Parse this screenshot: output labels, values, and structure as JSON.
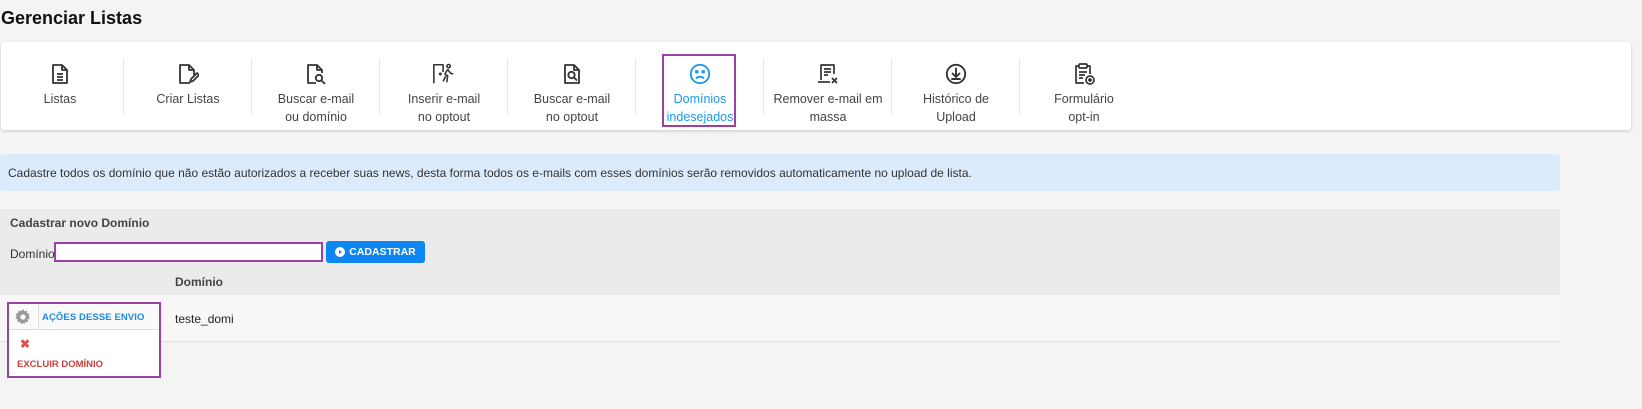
{
  "page": {
    "title": "Gerenciar Listas"
  },
  "toolbar": {
    "items": [
      {
        "line1": "Listas",
        "line2": "",
        "icon": "list-document-icon"
      },
      {
        "line1": "Criar Listas",
        "line2": "",
        "icon": "edit-document-icon"
      },
      {
        "line1": "Buscar e-mail",
        "line2": "ou domínio",
        "icon": "search-document-icon"
      },
      {
        "line1": "Inserir e-mail",
        "line2": "no optout",
        "icon": "exit-door-icon"
      },
      {
        "line1": "Buscar e-mail",
        "line2": "no optout",
        "icon": "search-file-icon"
      },
      {
        "line1": "Domínios",
        "line2": "indesejados",
        "icon": "sad-face-icon",
        "active": true
      },
      {
        "line1": "Remover e-mail em",
        "line2": "massa",
        "icon": "remove-mass-icon"
      },
      {
        "line1": "Histórico de",
        "line2": "Upload",
        "icon": "download-circle-icon"
      },
      {
        "line1": "Formulário",
        "line2": "opt-in",
        "icon": "clipboard-add-icon"
      }
    ],
    "active_color": "#1e9be6"
  },
  "info": {
    "text": "Cadastre todos os domínio que não estão autorizados a receber suas news, desta forma todos os e-mails com esses domínios serão removidos automaticamente no upload de lista."
  },
  "form": {
    "title": "Cadastrar novo Domínio",
    "label": "Domínio:",
    "value": "",
    "button": "CADASTRAR"
  },
  "table": {
    "column": "Domínio",
    "rows": [
      {
        "domain": "teste_domi"
      }
    ]
  },
  "actions": {
    "title": "AÇÕES DESSE ENVIO",
    "delete": "EXCLUIR DOMÍNIO"
  },
  "colors": {
    "primary": "#0d86f2",
    "highlight": "#9b3fa9",
    "danger": "#c9413b"
  }
}
